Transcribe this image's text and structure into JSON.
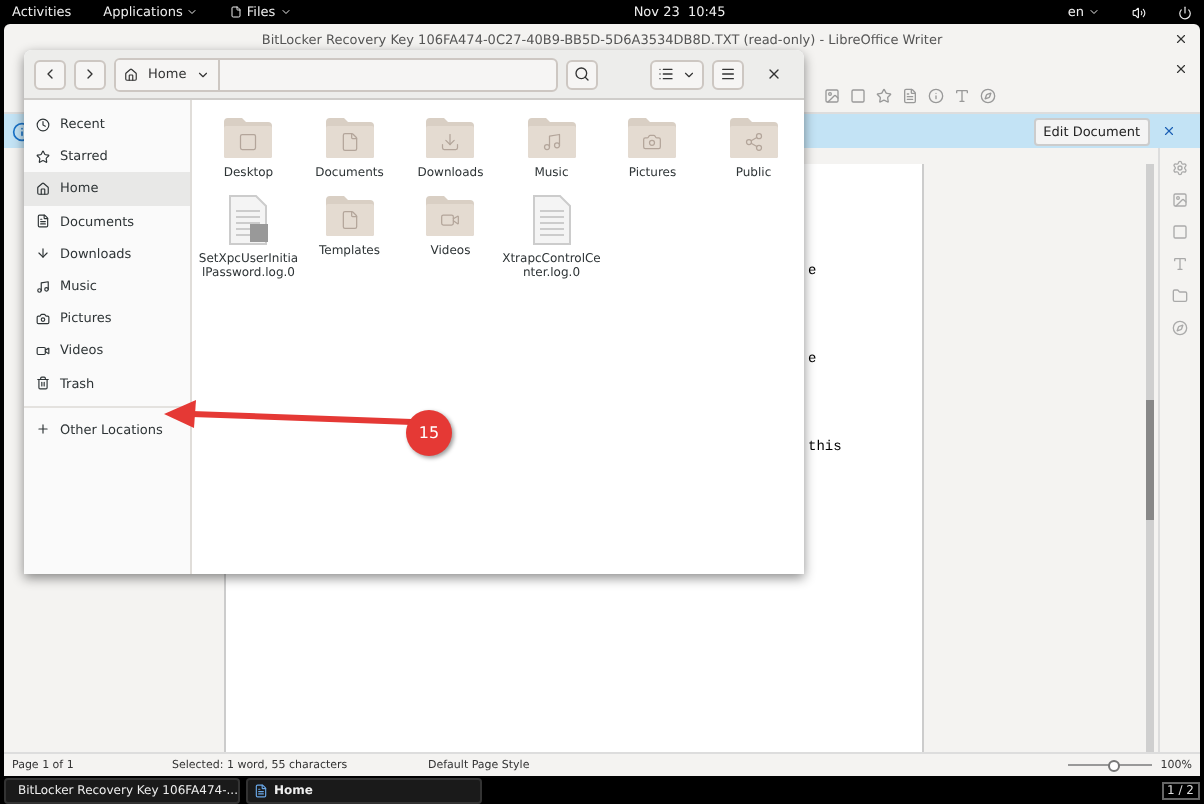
{
  "top_bar": {
    "activities": "Activities",
    "applications": "Applications",
    "app_menu": "Files",
    "clock": "Nov 23  10:45",
    "language": "en"
  },
  "writer": {
    "title": "BitLocker Recovery Key 106FA474-0C27-40B9-BB5D-5D6A3534DB8D.TXT (read-only) - LibreOffice Writer",
    "infobar_button": "Edit Document",
    "document_fragments": [
      "e",
      "e",
      "this"
    ],
    "status_bar": [
      "Page 1 of 1",
      "Selected: 1 word, 55 characters",
      "Default Page Style"
    ],
    "zoom": "100%",
    "zoom_slider": {
      "level": 0.55
    }
  },
  "files": {
    "path": "Home",
    "sidebar": [
      {
        "label": "Recent",
        "selected": false
      },
      {
        "label": "Starred",
        "selected": false
      },
      {
        "label": "Home",
        "selected": true
      },
      {
        "label": "Documents",
        "selected": false
      },
      {
        "label": "Downloads",
        "selected": false
      },
      {
        "label": "Music",
        "selected": false
      },
      {
        "label": "Pictures",
        "selected": false
      },
      {
        "label": "Videos",
        "selected": false
      },
      {
        "label": "Trash",
        "selected": false
      }
    ],
    "other_locations": "Other Locations",
    "items": [
      {
        "name": "Desktop",
        "kind": "folder"
      },
      {
        "name": "Documents",
        "kind": "folder"
      },
      {
        "name": "Downloads",
        "kind": "folder"
      },
      {
        "name": "Music",
        "kind": "folder"
      },
      {
        "name": "Pictures",
        "kind": "folder"
      },
      {
        "name": "Public",
        "kind": "folder"
      },
      {
        "name": "SetXpcUserInitialPassword.log.0",
        "kind": "file"
      },
      {
        "name": "Templates",
        "kind": "folder"
      },
      {
        "name": "Videos",
        "kind": "folder"
      },
      {
        "name": "XtrapcControlCenter.log.0",
        "kind": "file"
      }
    ]
  },
  "callout": {
    "number": "15"
  },
  "taskbar": {
    "tasks": [
      {
        "label": "BitLocker Recovery Key 106FA474-...",
        "selected": false
      },
      {
        "label": "Home",
        "selected": true
      }
    ],
    "workspace": "1 / 2"
  }
}
